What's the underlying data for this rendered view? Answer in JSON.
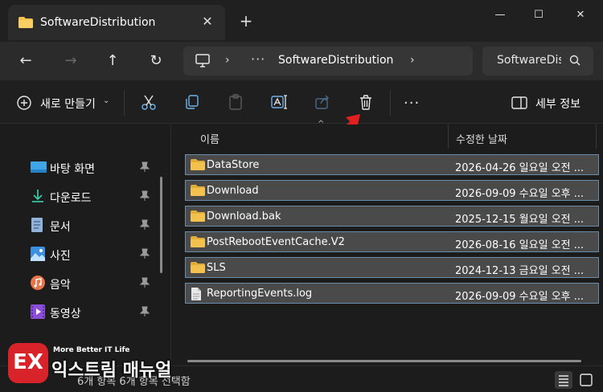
{
  "window": {
    "tab_title": "SoftwareDistribution",
    "new_tab": "+",
    "minimize": "—",
    "maximize": "☐",
    "close": "✕"
  },
  "nav": {
    "back": "←",
    "forward": "→",
    "up": "↑",
    "refresh": "↻",
    "address_more": "···",
    "address_sep": "›",
    "breadcrumb": "SoftwareDistribution",
    "search_text": "SoftwareDistribution"
  },
  "commands": {
    "new_label": "새로 만들기",
    "new_chevron": "⌄",
    "more": "···",
    "details_label": "세부 정보"
  },
  "sidebar": {
    "items": [
      {
        "label": "바탕 화면",
        "icon": "desktop-icon",
        "color": "#3fa5e8"
      },
      {
        "label": "다운로드",
        "icon": "download-icon",
        "color": "#38c4a0"
      },
      {
        "label": "문서",
        "icon": "document-icon",
        "color": "#8fb3d9"
      },
      {
        "label": "사진",
        "icon": "pictures-icon",
        "color": "#3d8fe0"
      },
      {
        "label": "음악",
        "icon": "music-icon",
        "color": "#e8744a"
      },
      {
        "label": "동영상",
        "icon": "video-icon",
        "color": "#8a4fd6"
      }
    ]
  },
  "list": {
    "sort_caret": "^",
    "col_name": "이름",
    "col_date": "수정한 날짜",
    "rows": [
      {
        "name": "DataStore",
        "date": "2026-04-26 일요일 오전 ...",
        "type": "folder"
      },
      {
        "name": "Download",
        "date": "2026-09-09 수요일 오후 ...",
        "type": "folder"
      },
      {
        "name": "Download.bak",
        "date": "2025-12-15 월요일 오전 ...",
        "type": "folder"
      },
      {
        "name": "PostRebootEventCache.V2",
        "date": "2026-08-16 일요일 오전 ...",
        "type": "folder"
      },
      {
        "name": "SLS",
        "date": "2024-12-13 금요일 오전 ...",
        "type": "folder"
      },
      {
        "name": "ReportingEvents.log",
        "date": "2026-09-09 수요일 오후 ...",
        "type": "file"
      }
    ]
  },
  "status": {
    "text": "6개 항목  6개 항목 선택함"
  },
  "watermark": {
    "logo": "EX",
    "tagline": "More Better IT Life",
    "name": "익스트림 매뉴얼"
  },
  "colors": {
    "folder": "#f2c14e",
    "accent": "#4aa3df",
    "arrow": "#e01f1f"
  }
}
